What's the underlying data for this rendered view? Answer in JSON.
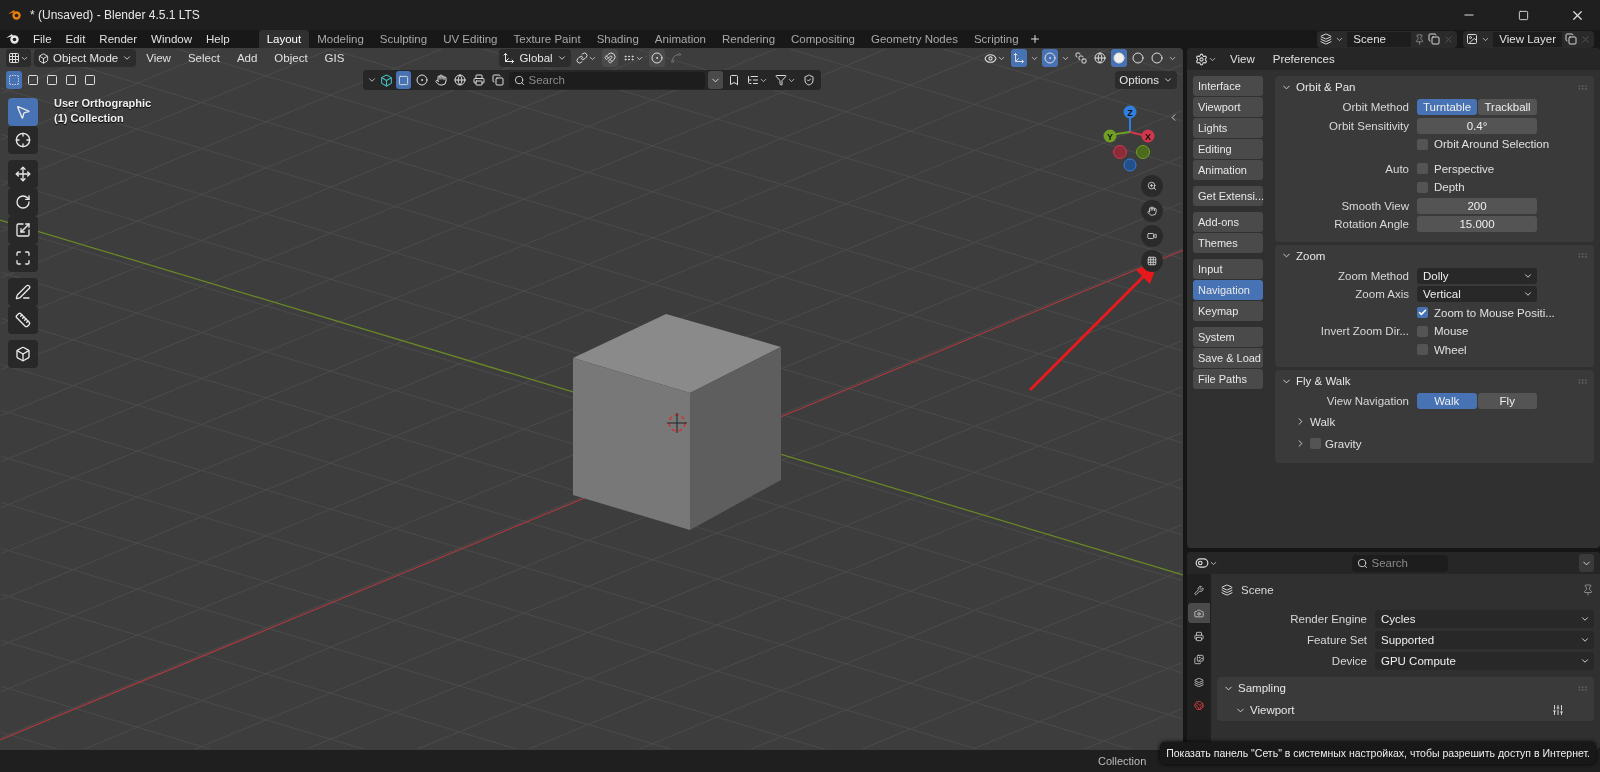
{
  "window": {
    "title": "* (Unsaved) - Blender 4.5.1 LTS"
  },
  "menu": [
    "File",
    "Edit",
    "Render",
    "Window",
    "Help"
  ],
  "workspaces": [
    {
      "label": "Layout",
      "selected": true
    },
    {
      "label": "Modeling",
      "selected": false
    },
    {
      "label": "Sculpting",
      "selected": false
    },
    {
      "label": "UV Editing",
      "selected": false
    },
    {
      "label": "Texture Paint",
      "selected": false
    },
    {
      "label": "Shading",
      "selected": false
    },
    {
      "label": "Animation",
      "selected": false
    },
    {
      "label": "Rendering",
      "selected": false
    },
    {
      "label": "Compositing",
      "selected": false
    },
    {
      "label": "Geometry Nodes",
      "selected": false
    },
    {
      "label": "Scripting",
      "selected": false
    }
  ],
  "scene_selector": {
    "scene": "Scene",
    "view_layer": "View Layer"
  },
  "viewport": {
    "mode": "Object Mode",
    "menus": [
      "View",
      "Select",
      "Add",
      "Object",
      "GIS"
    ],
    "orientation": "Global",
    "search": {
      "placeholder": "Search"
    },
    "options": "Options",
    "overlay_text": [
      "User Orthographic",
      "(1) Collection"
    ],
    "gizmo_axes": [
      {
        "label": "Z",
        "color": "#2f7fe0"
      },
      {
        "label": "Y",
        "color": "#6fa023"
      },
      {
        "label": "X",
        "color": "#d0374a"
      }
    ],
    "tool_groups": [
      [
        {
          "kind": "select",
          "selected": true
        },
        {
          "kind": "cursor",
          "selected": false
        }
      ],
      [
        {
          "kind": "move",
          "selected": false
        },
        {
          "kind": "rotate",
          "selected": false
        },
        {
          "kind": "scale",
          "selected": false
        },
        {
          "kind": "transform",
          "selected": false
        }
      ],
      [
        {
          "kind": "annotate",
          "selected": false
        },
        {
          "kind": "measure",
          "selected": false
        }
      ],
      [
        {
          "kind": "add_cube",
          "selected": false
        }
      ]
    ]
  },
  "preferences": {
    "menus": [
      "View",
      "Preferences"
    ],
    "nav_groups": [
      [
        {
          "label": "Interface",
          "selected": false
        },
        {
          "label": "Viewport",
          "selected": false
        },
        {
          "label": "Lights",
          "selected": false
        },
        {
          "label": "Editing",
          "selected": false
        },
        {
          "label": "Animation",
          "selected": false
        }
      ],
      [
        {
          "label": "Get Extensi...",
          "selected": false
        }
      ],
      [
        {
          "label": "Add-ons",
          "selected": false
        },
        {
          "label": "Themes",
          "selected": false
        }
      ],
      [
        {
          "label": "Input",
          "selected": false
        },
        {
          "label": "Navigation",
          "selected": true
        },
        {
          "label": "Keymap",
          "selected": false
        }
      ],
      [
        {
          "label": "System",
          "selected": false
        },
        {
          "label": "Save & Load",
          "selected": false
        },
        {
          "label": "File Paths",
          "selected": false
        }
      ]
    ],
    "panels": [
      {
        "title": "Orbit & Pan",
        "expanded": true,
        "rows": [
          {
            "kind": "toggle",
            "label": "Orbit Method",
            "options": [
              {
                "label": "Turntable",
                "selected": true
              },
              {
                "label": "Trackball",
                "selected": false
              }
            ]
          },
          {
            "kind": "number",
            "label": "Orbit Sensitivity",
            "value": "0.4°"
          },
          {
            "kind": "checkbox",
            "text": "Orbit Around Selection",
            "checked": false
          },
          {
            "kind": "separator"
          },
          {
            "kind": "checkbox",
            "label": "Auto",
            "text": "Perspective",
            "checked": false
          },
          {
            "kind": "checkbox",
            "text": "Depth",
            "checked": false
          },
          {
            "kind": "number",
            "label": "Smooth View",
            "value": "200"
          },
          {
            "kind": "number",
            "label": "Rotation Angle",
            "value": "15.000"
          }
        ]
      },
      {
        "title": "Zoom",
        "expanded": true,
        "rows": [
          {
            "kind": "dropdown",
            "label": "Zoom Method",
            "value": "Dolly"
          },
          {
            "kind": "dropdown",
            "label": "Zoom Axis",
            "value": "Vertical"
          },
          {
            "kind": "checkbox",
            "text": "Zoom to Mouse Positi...",
            "checked": true
          },
          {
            "kind": "checkbox",
            "label": "Invert Zoom Dir...",
            "text": "Mouse",
            "checked": false
          },
          {
            "kind": "checkbox",
            "text": "Wheel",
            "checked": false
          }
        ]
      },
      {
        "title": "Fly & Walk",
        "expanded": true,
        "rows": [
          {
            "kind": "toggle",
            "label": "View Navigation",
            "options": [
              {
                "label": "Walk",
                "selected": true
              },
              {
                "label": "Fly",
                "selected": false
              }
            ]
          },
          {
            "kind": "subpanel",
            "text": "Walk",
            "expanded": false
          },
          {
            "kind": "subpanel",
            "text": "Gravity",
            "expanded": false,
            "checked": false
          }
        ]
      }
    ]
  },
  "properties": {
    "search": {
      "placeholder": "Search"
    },
    "tabs": [
      {
        "kind": "tool",
        "selected": false
      },
      {
        "kind": "render",
        "selected": true
      },
      {
        "kind": "output",
        "selected": false
      },
      {
        "kind": "view_layer",
        "selected": false
      },
      {
        "kind": "scene",
        "selected": false
      },
      {
        "kind": "world",
        "selected": false
      }
    ],
    "context": "Scene",
    "rows": [
      {
        "label": "Render Engine",
        "value": "Cycles"
      },
      {
        "label": "Feature Set",
        "value": "Supported"
      },
      {
        "label": "Device",
        "value": "GPU Compute"
      }
    ],
    "panels": [
      {
        "title": "Sampling",
        "expanded": true,
        "subpanels": [
          {
            "title": "Viewport",
            "expanded": true
          }
        ]
      }
    ]
  },
  "status_bar": {
    "text": "Collection"
  },
  "tooltip": {
    "text": "Показать панель \"Сеть\" в системных настройках, чтобы разрешить доступ в Интернет."
  }
}
